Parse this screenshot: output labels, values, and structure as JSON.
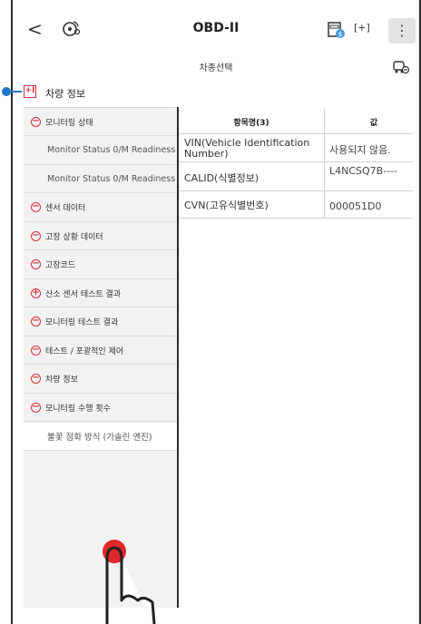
{
  "header": {
    "back_glyph": "<",
    "title": "OBD-II",
    "more_glyph": "⋮",
    "scan_glyph": "[+]"
  },
  "subheader": {
    "vehicle_select": "차종선택"
  },
  "section": {
    "expand_glyph": "+I",
    "title": "차량 정보"
  },
  "sidebar": {
    "items": [
      {
        "label": "모니터링 상태",
        "icon": "minus-circle-icon",
        "glyph": "−",
        "nested": false,
        "white": false
      },
      {
        "label": "Monitor Status 0/M Readiness",
        "icon": "",
        "glyph": "",
        "nested": true,
        "white": false
      },
      {
        "label": "Monitor Status 0/M Readiness",
        "icon": "",
        "glyph": "",
        "nested": true,
        "white": false
      },
      {
        "label": "센서 데이터",
        "icon": "minus-circle-icon",
        "glyph": "−",
        "nested": false,
        "white": false
      },
      {
        "label": "고장 상황 데이터",
        "icon": "minus-circle-icon",
        "glyph": "−",
        "nested": false,
        "white": false
      },
      {
        "label": "고장코드",
        "icon": "minus-circle-icon",
        "glyph": "−",
        "nested": false,
        "white": false
      },
      {
        "label": "산소 센서 테스트 결과",
        "icon": "plus-circle-icon",
        "glyph": "+",
        "nested": false,
        "white": false
      },
      {
        "label": "모니터링 테스트 결과",
        "icon": "minus-circle-icon",
        "glyph": "−",
        "nested": false,
        "white": false
      },
      {
        "label": "테스트 / 포괄적인 제어",
        "icon": "minus-circle-icon",
        "glyph": "−",
        "nested": false,
        "white": false
      },
      {
        "label": "차량 정보",
        "icon": "minus-circle-icon",
        "glyph": "−",
        "nested": false,
        "white": false
      },
      {
        "label": "모니터링 수행 횟수",
        "icon": "minus-circle-icon",
        "glyph": "−",
        "nested": false,
        "white": false
      },
      {
        "label": "불꽃 점화 방식 (가솔린 엔진)",
        "icon": "",
        "glyph": "",
        "nested": true,
        "white": true
      }
    ]
  },
  "table": {
    "col_name": "항목명(3)",
    "col_value": "값",
    "rows": [
      {
        "name": "VIN(Vehicle Identification Number)",
        "value": "사용되지 않음."
      },
      {
        "name": "CALID(식별정보)",
        "value": "L4NCSQ7B----"
      },
      {
        "name": "CVN(고유식별번호)",
        "value": "000051D0"
      }
    ]
  },
  "colors": {
    "accent_red": "#d6303a",
    "pointer_blue": "#1c76c9",
    "sidebar_bg": "#f2f2f2"
  }
}
